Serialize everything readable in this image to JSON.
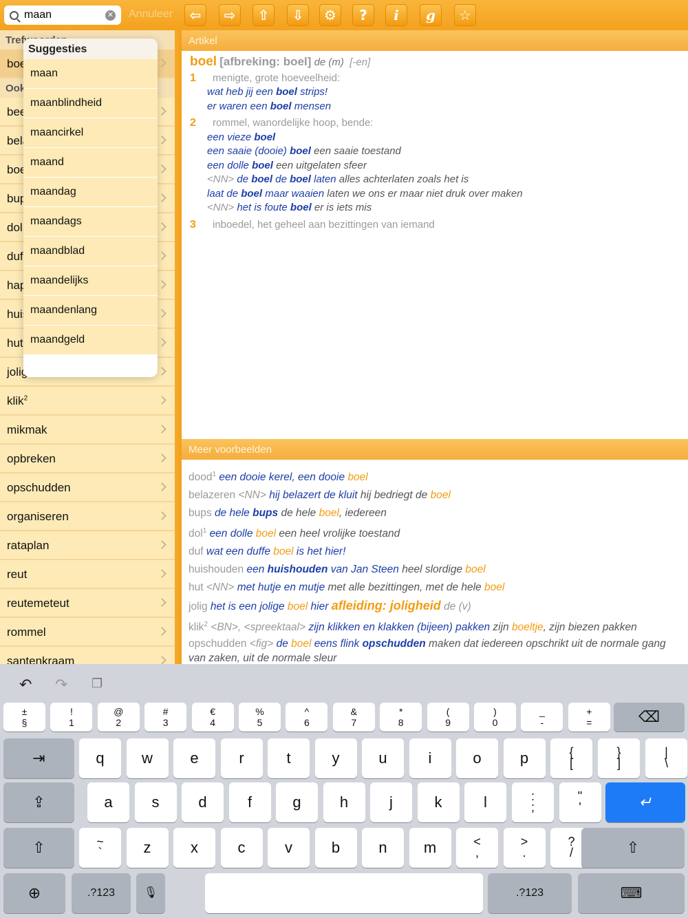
{
  "search": {
    "value": "maan",
    "cancel_label": "Annuleer"
  },
  "toolbar_buttons": [
    {
      "name": "back-arrow-icon",
      "glyph": "⇦"
    },
    {
      "name": "forward-arrow-icon",
      "glyph": "⇨"
    },
    {
      "name": "up-arrow-icon",
      "glyph": "⇧"
    },
    {
      "name": "down-arrow-icon",
      "glyph": "⇩"
    },
    {
      "name": "settings-gear-icon",
      "glyph": "⚙"
    },
    {
      "name": "help-icon",
      "glyph": "?"
    },
    {
      "name": "info-icon",
      "glyph": "i"
    },
    {
      "name": "grammar-icon",
      "glyph": "g"
    },
    {
      "name": "favorite-star-icon",
      "glyph": "☆"
    }
  ],
  "left": {
    "section1": "Trefwoorden",
    "selected_item": "boel",
    "section2": "Ook",
    "items": [
      "beetje",
      "belazeren",
      "boel",
      "bups",
      "dol",
      "duf",
      "happen",
      "huishouden",
      "hut",
      "jolig",
      "klik",
      "mikmak",
      "opbreken",
      "opschudden",
      "organiseren",
      "rataplan",
      "reut",
      "reutemeteut",
      "rommel",
      "santenkraam"
    ]
  },
  "suggestions": {
    "title": "Suggesties",
    "items": [
      "maan",
      "maanblindheid",
      "maancirkel",
      "maand",
      "maandag",
      "maandags",
      "maandblad",
      "maandelijks",
      "maandenlang",
      "maandgeld"
    ]
  },
  "article": {
    "header": "Artikel",
    "headword": "boel",
    "hyphenation": "[afbreking: boel]",
    "gender": "de (m)",
    "plural": "[-en]",
    "sense1_num": "1",
    "sense1_def": "menigte, grote hoeveelheid:",
    "sense2_num": "2",
    "sense2_def": "rommel, wanordelijke hoop, bende:",
    "sense3_num": "3",
    "sense3_def": "inboedel, het geheel aan bezittingen van iemand"
  },
  "more": {
    "header": "Meer voorbeelden"
  },
  "keyboard": {
    "row1": [
      [
        "±",
        "§"
      ],
      [
        "!",
        "1"
      ],
      [
        "@",
        "2"
      ],
      [
        "#",
        "3"
      ],
      [
        "€",
        "4"
      ],
      [
        "%",
        "5"
      ],
      [
        "^",
        "6"
      ],
      [
        "&",
        "7"
      ],
      [
        "*",
        "8"
      ],
      [
        "(",
        "9"
      ],
      [
        ")",
        "0"
      ],
      [
        "_",
        "-"
      ],
      [
        "+",
        "="
      ]
    ],
    "row2": [
      "q",
      "w",
      "e",
      "r",
      "t",
      "y",
      "u",
      "i",
      "o",
      "p"
    ],
    "row2_sym": [
      [
        "{",
        "["
      ],
      [
        "}",
        "]"
      ],
      [
        "|",
        "\\"
      ]
    ],
    "row3": [
      "a",
      "s",
      "d",
      "f",
      "g",
      "h",
      "j",
      "k",
      "l"
    ],
    "row3_sym": [
      [
        ":",
        ";"
      ],
      [
        "\"",
        "'"
      ]
    ],
    "row4": [
      "z",
      "x",
      "c",
      "v",
      "b",
      "n",
      "m"
    ],
    "row4_sym": [
      [
        "~",
        "`"
      ],
      [
        "<",
        ","
      ],
      [
        ">",
        "."
      ],
      [
        "?",
        "/"
      ]
    ],
    "numbers_label": ".?123"
  }
}
